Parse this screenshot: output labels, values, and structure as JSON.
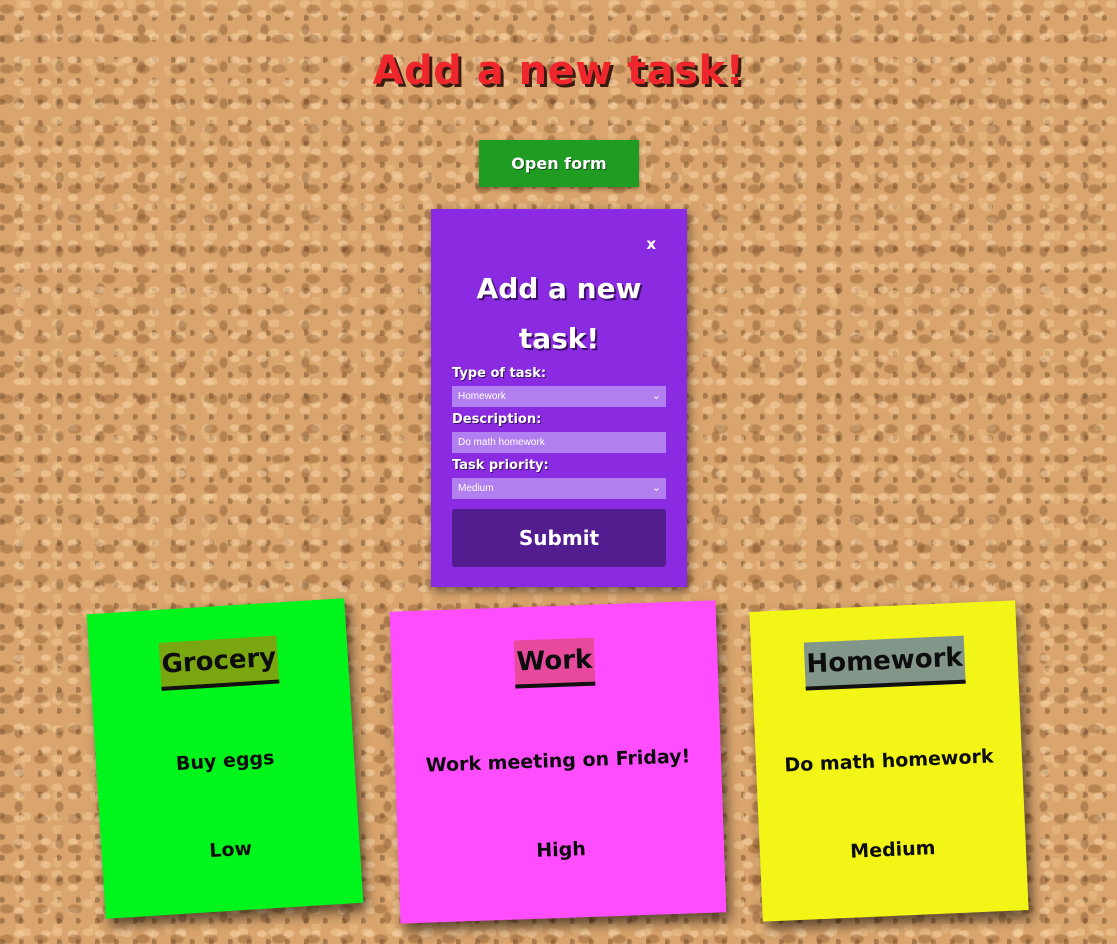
{
  "header": {
    "title": "Add a new task!",
    "open_form_label": "Open form"
  },
  "modal": {
    "close_label": "x",
    "title": "Add a new task!",
    "type_label": "Type of task:",
    "type_value": "Homework",
    "description_label": "Description:",
    "description_value": "Do math homework",
    "priority_label": "Task priority:",
    "priority_value": "Medium",
    "submit_label": "Submit"
  },
  "notes": [
    {
      "type": "Grocery",
      "description": "Buy eggs",
      "priority": "Low",
      "color": "#00f51d",
      "tag_color": "#7aa70f"
    },
    {
      "type": "Work",
      "description": "Work meeting on Friday!",
      "priority": "High",
      "color": "#ff4dff",
      "tag_color": "#e74a9c"
    },
    {
      "type": "Homework",
      "description": "Do math homework",
      "priority": "Medium",
      "color": "#f2f516",
      "tag_color": "#83968a"
    }
  ],
  "colors": {
    "title_red": "#f0262d",
    "open_button_green": "#1f9c21",
    "modal_purple": "#8a2be2",
    "submit_purple": "#531c8f",
    "cork": "#d9a46d"
  }
}
